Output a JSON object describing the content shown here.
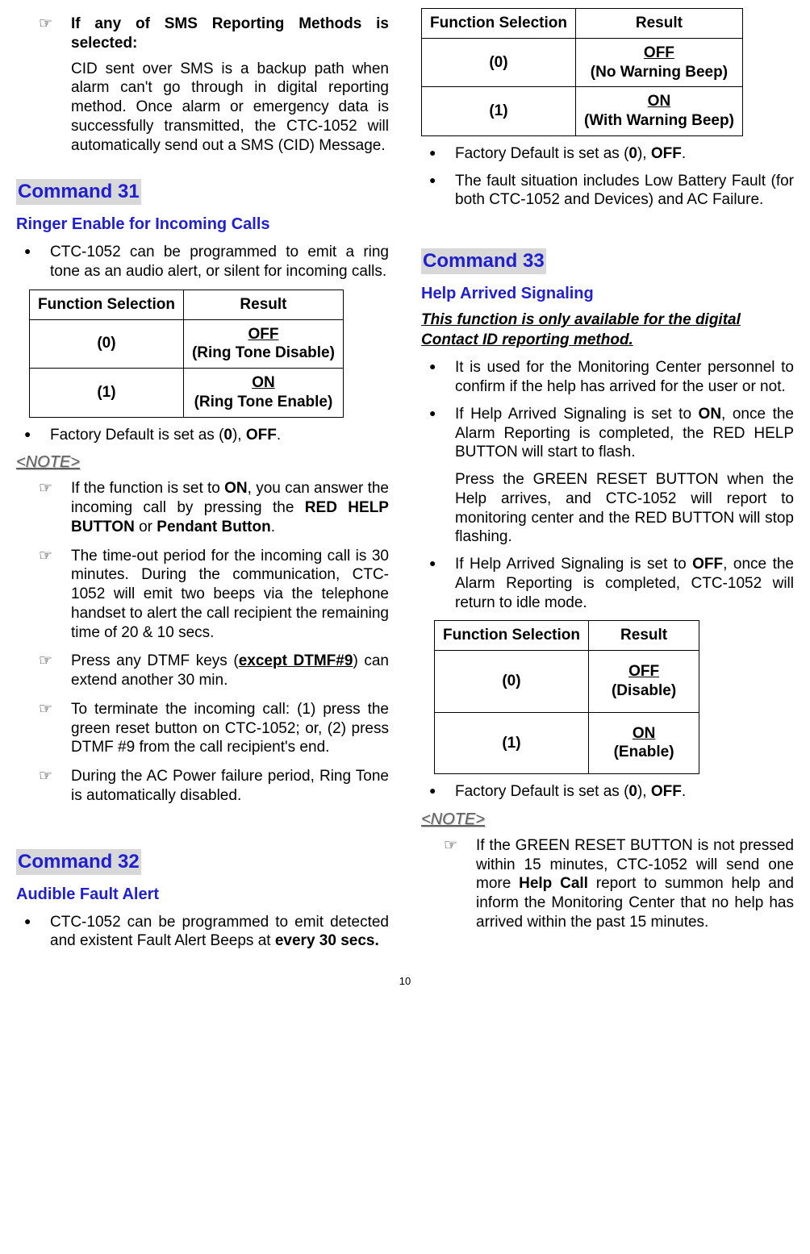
{
  "col1": {
    "top_pointer": {
      "lead": "If any of SMS Reporting Methods is selected:",
      "body": "CID sent over SMS is a backup path when alarm can't go through in digital reporting method. Once alarm or emergency data is successfully transmitted, the CTC-1052 will automatically send out a SMS (CID) Message."
    },
    "cmd31": {
      "heading": "Command 31",
      "sub": "Ringer Enable for Incoming Calls",
      "intro": "CTC-1052 can be programmed to emit a ring tone as an audio alert, or silent for incoming calls.",
      "table": {
        "h1": "Function Selection",
        "h2": "Result",
        "r0_sel": "(0)",
        "r0_main": "OFF",
        "r0_sub": "(Ring Tone Disable)",
        "r1_sel": "(1)",
        "r1_main": "ON",
        "r1_sub": "(Ring Tone Enable)"
      },
      "default_pre": "Factory Default is set as (",
      "default_val": "0",
      "default_post": "), ",
      "default_off": "OFF",
      "default_end": ".",
      "note_label": "<NOTE>",
      "n1_a": "If the function is set to ",
      "n1_b": "ON",
      "n1_c": ", you can answer the incoming call by pressing the ",
      "n1_d": "RED HELP BUTTON",
      "n1_e": " or ",
      "n1_f": "Pendant Button",
      "n1_g": ".",
      "n2": "The time-out period for the incoming call is 30 minutes. During the communication, CTC-1052 will emit two beeps via the telephone handset to alert the call recipient the remaining time of 20 & 10 secs.",
      "n3_a": "Press any DTMF keys (",
      "n3_b": "except DTMF#9",
      "n3_c": ") can extend another 30 min.",
      "n4": "To terminate the incoming call: (1) press the green reset button on CTC-1052; or, (2) press DTMF #9 from the call recipient's end.",
      "n5": "During the AC Power failure period, Ring Tone is automatically disabled."
    },
    "cmd32": {
      "heading": "Command 32",
      "sub": "Audible Fault Alert",
      "intro_a": "CTC-1052 can be programmed to emit detected and existent Fault Alert Beeps at ",
      "intro_b": "every 30 secs."
    }
  },
  "col2": {
    "table32": {
      "h1": "Function Selection",
      "h2": "Result",
      "r0_sel": "(0)",
      "r0_main": "OFF",
      "r0_sub": "(No Warning Beep)",
      "r1_sel": "(1)",
      "r1_main": "ON",
      "r1_sub": "(With Warning Beep)"
    },
    "d32_pre": "Factory Default is set as (",
    "d32_val": "0",
    "d32_post": "), ",
    "d32_off": "OFF",
    "d32_end": ".",
    "d32_fault": "The fault situation includes Low Battery Fault (for both CTC-1052 and Devices) and AC Failure.",
    "cmd33": {
      "heading": "Command 33",
      "sub": "Help Arrived Signaling",
      "availability": "This function is only available for the digital Contact ID reporting method.",
      "b1": "It is used for the Monitoring Center personnel to confirm if the help has arrived for the user or not.",
      "b2_a": "If Help Arrived Signaling is set to ",
      "b2_b": "ON",
      "b2_c": ", once the Alarm Reporting is completed, the RED HELP BUTTON will start to flash.",
      "b2_cont": "Press the GREEN RESET BUTTON when the Help arrives, and CTC-1052 will report to monitoring center and the RED BUTTON will stop flashing.",
      "b3_a": "If Help Arrived Signaling is set to ",
      "b3_b": "OFF",
      "b3_c": ", once the Alarm Reporting is completed, CTC-1052 will return to idle mode.",
      "table": {
        "h1": "Function Selection",
        "h2": "Result",
        "r0_sel": "(0)",
        "r0_main": "OFF",
        "r0_sub": "(Disable)",
        "r1_sel": "(1)",
        "r1_main": "ON",
        "r1_sub": "(Enable)"
      },
      "d_pre": "Factory Default is set as (",
      "d_val": "0",
      "d_post": "), ",
      "d_off": "OFF",
      "d_end": ".",
      "note_label": "<NOTE>",
      "note_a": "If the GREEN RESET BUTTON is not pressed within 15 minutes, CTC-1052 will send one more ",
      "note_b": "Help Call",
      "note_c": " report to summon help and inform the Monitoring Center that no help has arrived within the past 15 minutes."
    }
  },
  "page_num": "10"
}
